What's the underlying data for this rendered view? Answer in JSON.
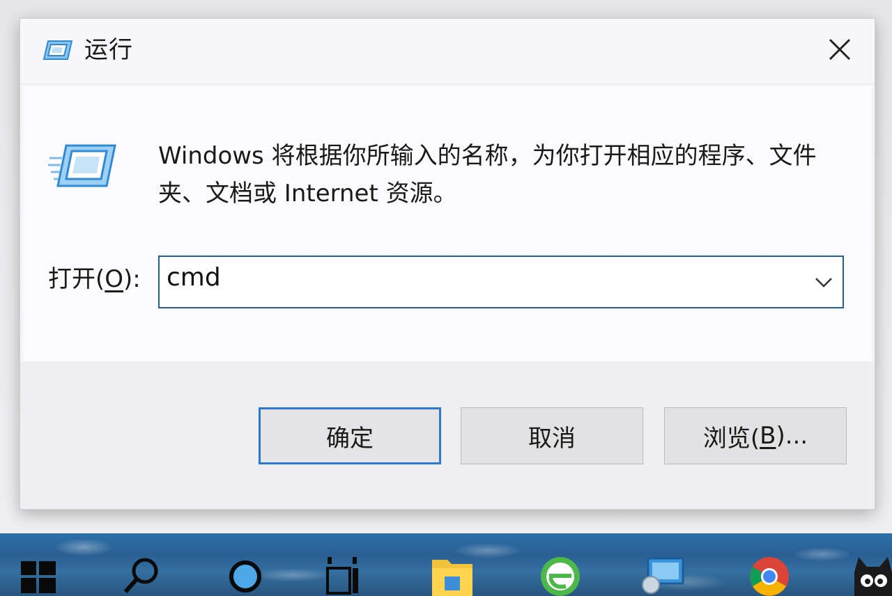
{
  "dialog": {
    "title": "运行",
    "description": "Windows 将根据你所输入的名称，为你打开相应的程序、文件夹、文档或 Internet 资源。",
    "open_label_prefix": "打开(",
    "open_label_key": "O",
    "open_label_suffix": "):",
    "command_value": "cmd",
    "ok_label": "确定",
    "cancel_label": "取消",
    "browse_prefix": "浏览(",
    "browse_key": "B",
    "browse_suffix": ")..."
  },
  "colors": {
    "accent": "#2a78d4",
    "field_border": "#1f5fa0"
  },
  "taskbar": {
    "icons": [
      "windows-start-icon",
      "search-icon",
      "cortana-icon",
      "task-view-icon",
      "file-explorer-icon",
      "browser-e-icon",
      "remote-desktop-icon",
      "chrome-icon",
      "mascot-app-icon"
    ]
  }
}
